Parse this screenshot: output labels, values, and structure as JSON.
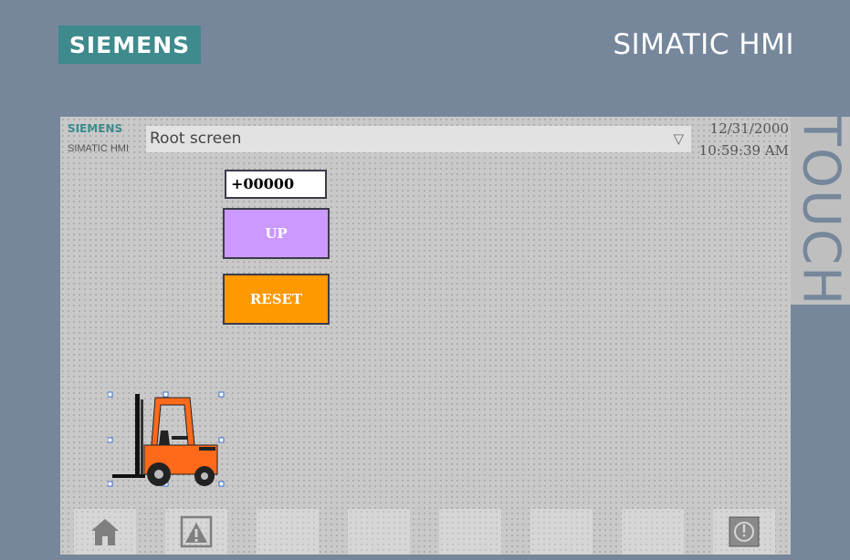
{
  "device": {
    "brand": "SIEMENS",
    "title": "SIMATIC HMI",
    "side_label": "TOUCH"
  },
  "header": {
    "logo": "SIEMENS",
    "logo_sub": "SIMATIC HMI",
    "screen_selector": "Root screen",
    "date": "12/31/2000",
    "time": "10:59:39 AM"
  },
  "controls": {
    "counter_value": "+00000",
    "up_label": "UP",
    "reset_label": "RESET"
  },
  "function_keys": [
    {
      "icon": "home-icon"
    },
    {
      "icon": "alarm-warning-icon"
    },
    {
      "icon": ""
    },
    {
      "icon": ""
    },
    {
      "icon": ""
    },
    {
      "icon": ""
    },
    {
      "icon": ""
    },
    {
      "icon": "power-icon"
    }
  ],
  "colors": {
    "bezel": "#76879b",
    "brand": "#3e8a8c",
    "up_button": "#cc99ff",
    "reset_button": "#ff9900",
    "forklift": "#ff6a1a"
  }
}
